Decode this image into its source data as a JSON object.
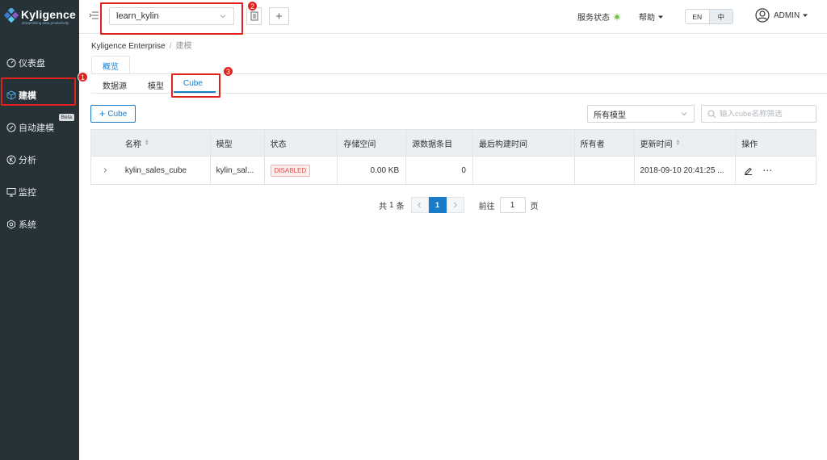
{
  "brand": {
    "name": "Kyligence",
    "tagline": "streamlining data productivity"
  },
  "sidebar": {
    "items": [
      {
        "label": "仪表盘",
        "icon": "dashboard-icon"
      },
      {
        "label": "建模",
        "icon": "cube-icon",
        "active": true
      },
      {
        "label": "自动建模",
        "icon": "auto-modeling-icon",
        "badge": "Beta"
      },
      {
        "label": "分析",
        "icon": "analysis-icon"
      },
      {
        "label": "监控",
        "icon": "monitor-icon"
      },
      {
        "label": "系统",
        "icon": "system-icon"
      }
    ]
  },
  "header": {
    "project": "learn_kylin",
    "service_status": "服务状态",
    "help": "帮助",
    "lang": {
      "en": "EN",
      "zh": "中",
      "selected": "中"
    },
    "user": "ADMIN"
  },
  "annotations": [
    "1",
    "2",
    "3"
  ],
  "breadcrumb": {
    "root": "Kyligence Enterprise",
    "separator": "/",
    "current": "建模"
  },
  "tabs": {
    "overview": "概览"
  },
  "subtabs": [
    "数据源",
    "模型",
    "Cube"
  ],
  "toolbar": {
    "add_cube": "Cube",
    "model_filter": "所有模型",
    "search_placeholder": "输入cube名称筛选"
  },
  "table": {
    "headers": [
      "名称",
      "模型",
      "状态",
      "存储空间",
      "源数据条目",
      "最后构建时间",
      "所有者",
      "更新时间",
      "操作"
    ],
    "rows": [
      {
        "name": "kylin_sales_cube",
        "model": "kylin_sal...",
        "status": "DISABLED",
        "storage": "0.00 KB",
        "source_records": "0",
        "last_build": "",
        "owner": "",
        "updated": "2018-09-10 20:41:25 ..."
      }
    ]
  },
  "pagination": {
    "total_prefix": "共",
    "total": "1",
    "total_suffix": "条",
    "current_page": "1",
    "goto_label": "前往",
    "goto_value": "1",
    "page_suffix": "页"
  },
  "colors": {
    "accent": "#1a7bc7",
    "sidebar_bg": "#263238",
    "annotation": "#e0221b",
    "disabled": "#e24c4c"
  }
}
